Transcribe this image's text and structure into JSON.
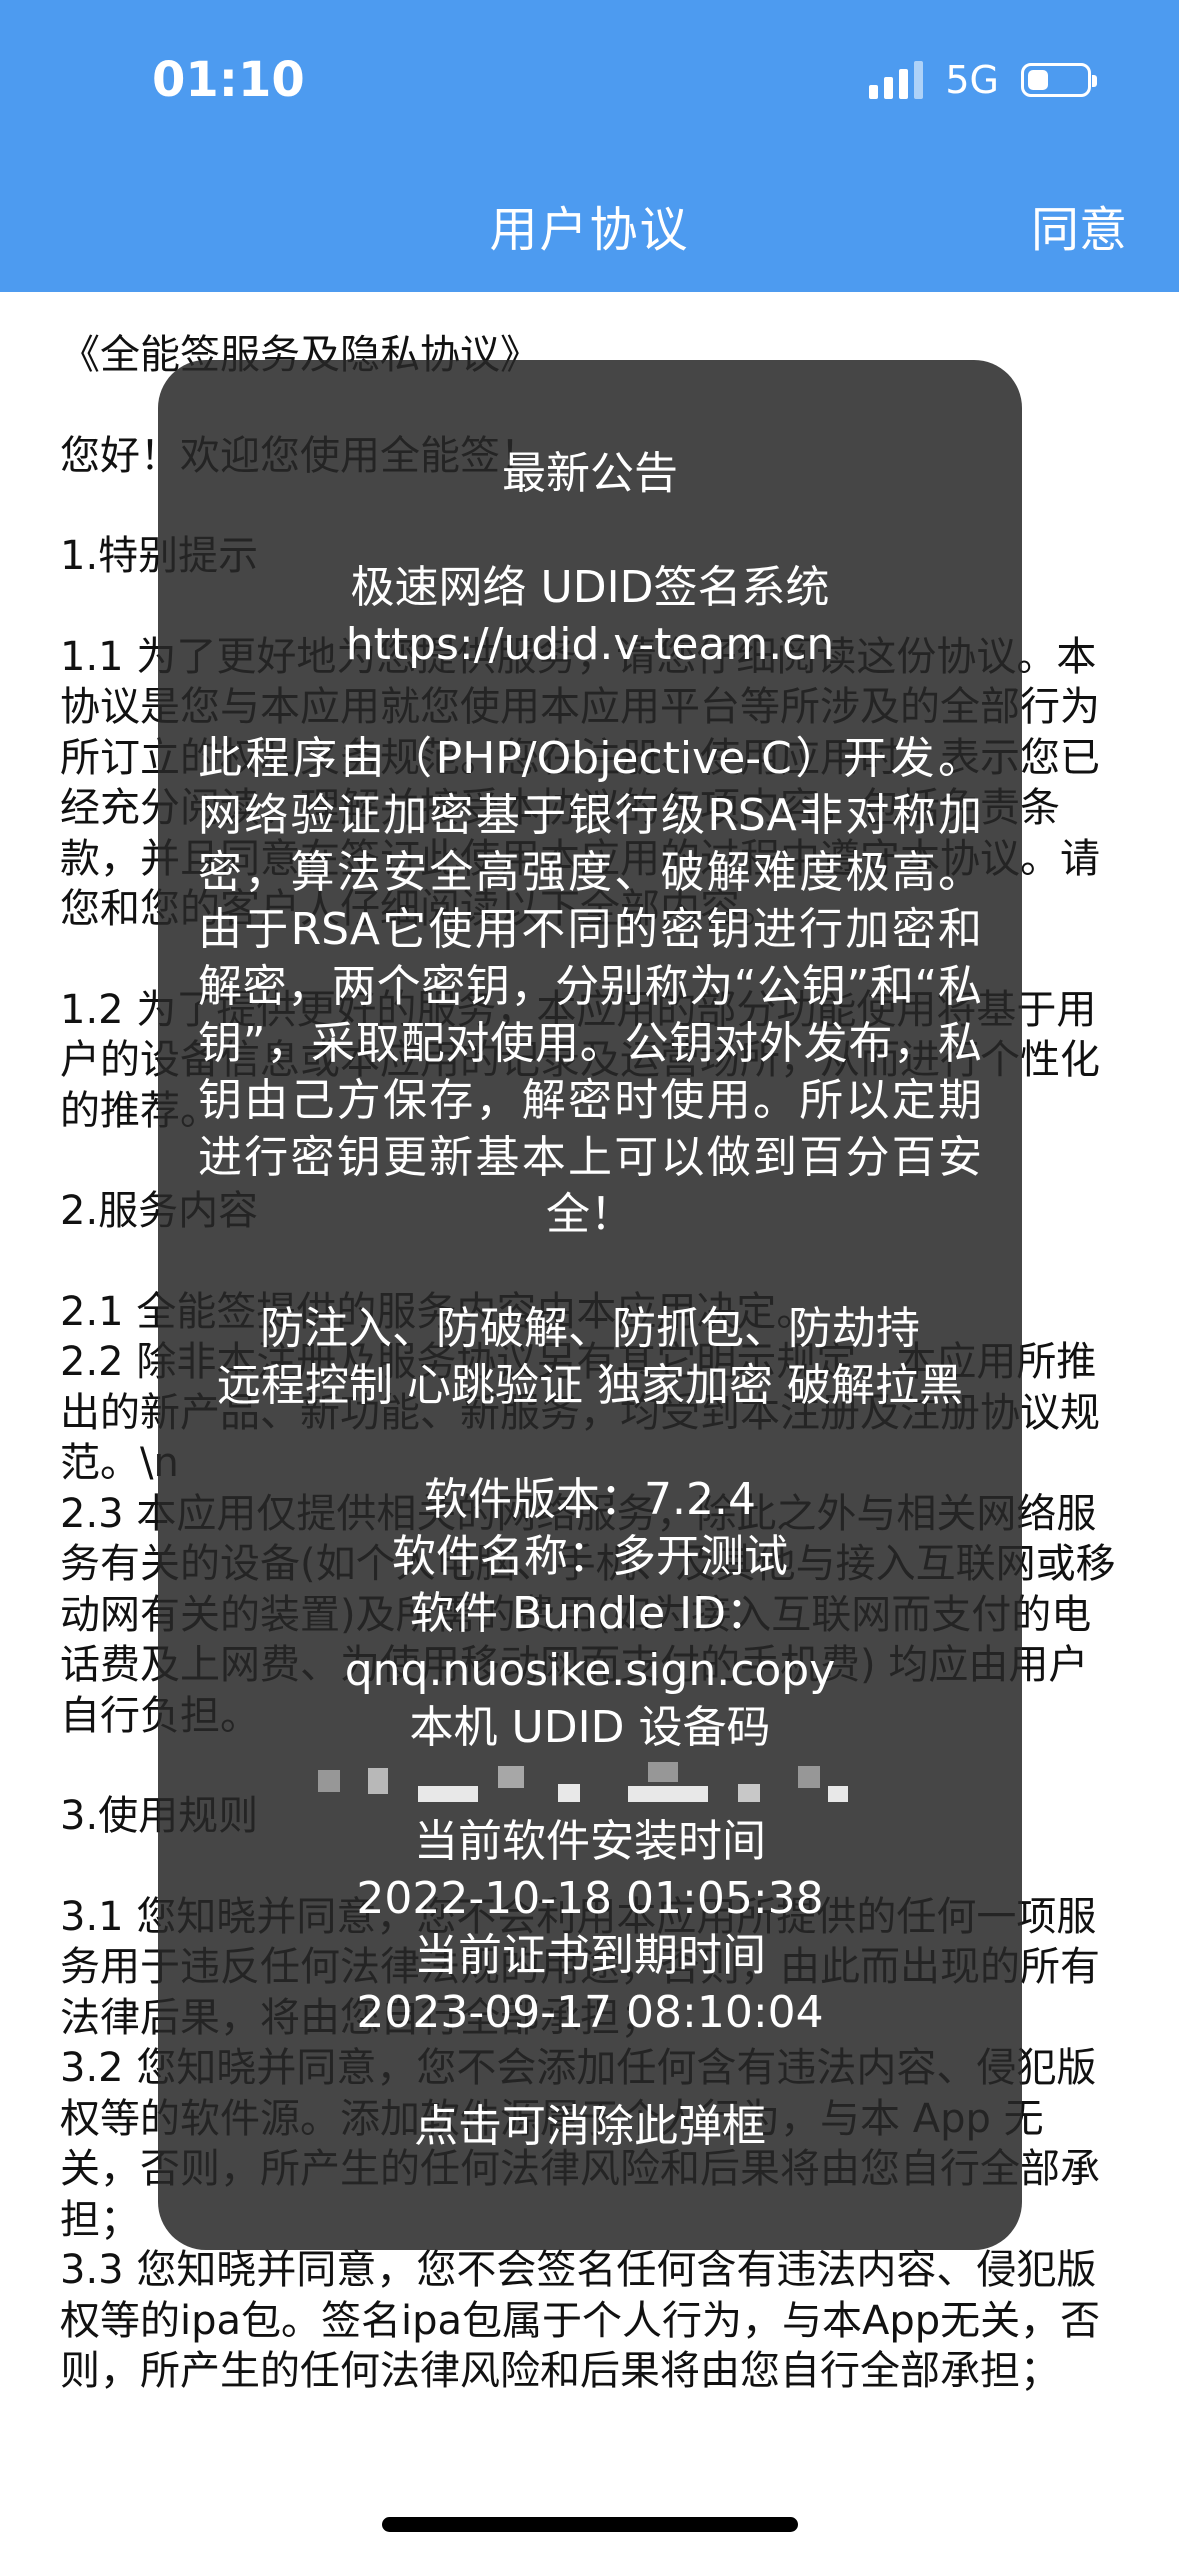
{
  "status_bar": {
    "time": "01:10",
    "network": "5G",
    "icons": [
      "signal-icon",
      "battery-icon"
    ]
  },
  "nav": {
    "title": "用户协议",
    "action": "同意"
  },
  "agreement": {
    "paragraphs": [
      "《全能签服务及隐私协议》",
      "",
      "您好！欢迎您使用全能签！",
      "",
      "1.特别提示",
      "",
      "1.1 为了更好地为您提供服务，请您仔细阅读这份协议。本协议是您与本应用就您使用本应用平台等所涉及的全部行为所订立的权利义务规范。您在注册、使用应用时，表示您已经充分阅读、理解并接受本协议的各项内容，包括免责条款，并且同意在签订此使用本应用的过程中遵守本协议。请您和您的客户人仔细阅读以下全部内容。",
      "",
      "1.2 为了提供更好的服务，本应用的部分功能使用将基于用户的设备信息或本应用的记录及运营场所，从而进行个性化的推荐。",
      "",
      "2.服务内容",
      "",
      "2.1 全能签提供的服务内容由本应用决定。",
      "2.2 除非本注册及服务协议另有其它明示规定，本应用所推出的新产品、新功能、新服务，均受到本注册及注册协议规范。\\n",
      "2.3 本应用仅提供相关的网络服务，除此之外与相关网络服务有关的设备(如个人电脑、手机、及其他与接入互联网或移动网有关的装置)及所需的费用(如为接入互联网而支付的电话费及上网费、为使用移动网而支付的手机费) 均应由用户自行负担。",
      "",
      "3.使用规则",
      "",
      "3.1 您知晓并同意，您不会利用本应用所提供的任何一项服务用于违反任何法律法规的用途，否则，由此而出现的所有法律后果，将由您自行全部承担；",
      "3.2 您知晓并同意，您不会添加任何含有违法内容、侵犯版权等的软件源。添加软件源属于个人行为，与本 App 无关，否则，所产生的任何法律风险和后果将由您自行全部承担；",
      "3.3 您知晓并同意，您不会签名任何含有违法内容、侵犯版权等的ipa包。签名ipa包属于个人行为，与本App无关，否则，所产生的任何法律风险和后果将由您自行全部承担；"
    ]
  },
  "popup": {
    "title": "最新公告",
    "system_name": "极速网络 UDID签名系统",
    "url": "https://udid.v-team.cn",
    "description": "此程序由（PHP/Objective-C）开发。网络验证加密基于银行级RSA非对称加密，算法安全高强度、破解难度极高。由于RSA它使用不同的密钥进行加密和解密，两个密钥，分别称为“公钥”和“私钥”，采取配对使用。公钥对外发布，私钥由己方保存，解密时使用。所以定期进行密钥更新基本上可以做到百分百安全！",
    "features_line1": "防注入、防破解、防抓包、防劫持",
    "features_line2": "远程控制 心跳验证 独家加密 破解拉黑",
    "version": "软件版本：7.2.4",
    "app_name": "软件名称：多开测试",
    "bundle_label": "软件 Bundle ID：",
    "bundle_id": "qnq.nuosike.sign.copy",
    "udid_label": "本机 UDID 设备码",
    "install_time_label": "当前软件安装时间",
    "install_time": "2022-10-18 01:05:38",
    "expire_label": "当前证书到期时间",
    "expire_time": "2023-09-17 08:10:04",
    "dismiss": "点击可消除此弹框"
  }
}
